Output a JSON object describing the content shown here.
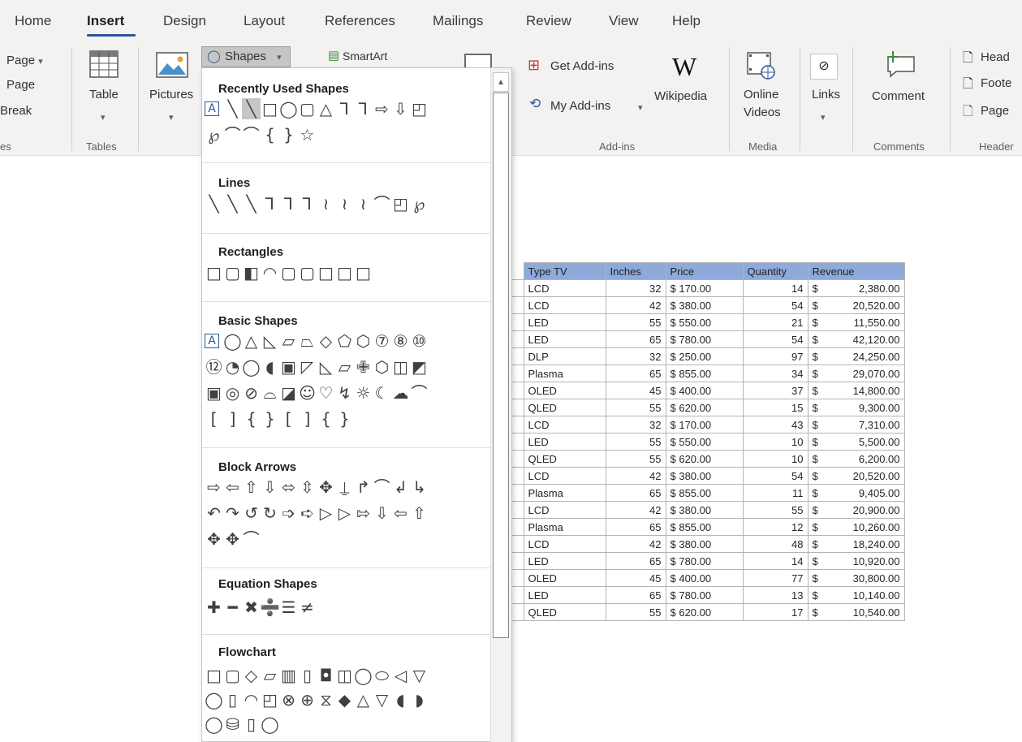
{
  "tabs": [
    "Home",
    "Insert",
    "Design",
    "Layout",
    "References",
    "Mailings",
    "Review",
    "View",
    "Help"
  ],
  "ribbon": {
    "pages_items": [
      "Page",
      "Page",
      "Break"
    ],
    "pages_group_partial": "es",
    "table_label": "Table",
    "tables_group": "Tables",
    "pictures_label": "Pictures",
    "shapes_label": "Shapes",
    "smartart_label": "SmartArt",
    "get_addins_label": "Get Add-ins",
    "my_addins_label": "My Add-ins",
    "wikipedia_label": "Wikipedia",
    "addins_group": "Add-ins",
    "online_videos_label": [
      "Online",
      "Videos"
    ],
    "media_group": "Media",
    "links_label": "Links",
    "comment_label": "Comment",
    "comments_group": "Comments",
    "header_items": [
      "Head",
      "Foote",
      "Page"
    ],
    "header_group": "Header"
  },
  "shapes_menu": {
    "sections": [
      {
        "title": "Recently Used Shapes",
        "rows": [
          "A╲╲□◯▢△⅂⅂⇨⇩◰",
          "℘⌒⌒{}☆"
        ]
      },
      {
        "title": "Lines",
        "rows": [
          "╲╲╲⅂⅂⅂≀≀≀⌒◰℘"
        ]
      },
      {
        "title": "Rectangles",
        "rows": [
          "□▢◧◠▢▢□□□"
        ]
      },
      {
        "title": "Basic Shapes",
        "rows": [
          "A◯△◺▱⏢◇⬠⬡⑦⑧⑩",
          "⑫◔◯◖▣◸◺▱✙⬡◫◩",
          "▣◎⊘⌓◪☺♡↯☼☾☁⌒",
          "[]{}[]{}"
        ]
      },
      {
        "title": "Block Arrows",
        "rows": [
          "⇨⇦⇧⇩⬄⇳✥⍊↱⌒↲↳",
          "↶↷↺↻➩➪▷▷⇰⇩⇦⇧",
          "✥✥⌒"
        ]
      },
      {
        "title": "Equation Shapes",
        "rows": [
          "✚━✖➗☰≠"
        ]
      },
      {
        "title": "Flowchart",
        "rows": [
          "□▢◇▱▥▯◘◫◯⬭◁▽",
          "◯▯◠◰⊗⊕⧖◆△▽◖◗",
          "◯⛁▯◯"
        ]
      }
    ]
  },
  "table": {
    "headers": [
      "Type TV",
      "Inches",
      "Price",
      "Quantity",
      "Revenue"
    ],
    "rows": [
      [
        "LCD",
        "32",
        "$ 170.00",
        "14",
        "$",
        "2,380.00"
      ],
      [
        "LCD",
        "42",
        "$ 380.00",
        "54",
        "$",
        "20,520.00"
      ],
      [
        "LED",
        "55",
        "$ 550.00",
        "21",
        "$",
        "11,550.00"
      ],
      [
        "LED",
        "65",
        "$ 780.00",
        "54",
        "$",
        "42,120.00"
      ],
      [
        "DLP",
        "32",
        "$ 250.00",
        "97",
        "$",
        "24,250.00"
      ],
      [
        "Plasma",
        "65",
        "$ 855.00",
        "34",
        "$",
        "29,070.00"
      ],
      [
        "OLED",
        "45",
        "$ 400.00",
        "37",
        "$",
        "14,800.00"
      ],
      [
        "QLED",
        "55",
        "$ 620.00",
        "15",
        "$",
        "9,300.00"
      ],
      [
        "LCD",
        "32",
        "$ 170.00",
        "43",
        "$",
        "7,310.00"
      ],
      [
        "LED",
        "55",
        "$ 550.00",
        "10",
        "$",
        "5,500.00"
      ],
      [
        "QLED",
        "55",
        "$ 620.00",
        "10",
        "$",
        "6,200.00"
      ],
      [
        "LCD",
        "42",
        "$ 380.00",
        "54",
        "$",
        "20,520.00"
      ],
      [
        "Plasma",
        "65",
        "$ 855.00",
        "11",
        "$",
        "9,405.00"
      ],
      [
        "LCD",
        "42",
        "$ 380.00",
        "55",
        "$",
        "20,900.00"
      ],
      [
        "Plasma",
        "65",
        "$ 855.00",
        "12",
        "$",
        "10,260.00"
      ],
      [
        "LCD",
        "42",
        "$ 380.00",
        "48",
        "$",
        "18,240.00"
      ],
      [
        "LED",
        "65",
        "$ 780.00",
        "14",
        "$",
        "10,920.00"
      ],
      [
        "OLED",
        "45",
        "$ 400.00",
        "77",
        "$",
        "30,800.00"
      ],
      [
        "LED",
        "65",
        "$ 780.00",
        "13",
        "$",
        "10,140.00"
      ],
      [
        "QLED",
        "55",
        "$ 620.00",
        "17",
        "$",
        "10,540.00"
      ]
    ],
    "stub_marks": [
      "",
      "",
      "",
      "",
      "",
      "",
      "",
      "",
      "",
      "",
      "",
      "",
      "",
      "",
      "",
      "",
      "",
      "",
      "",
      ""
    ]
  },
  "colors": {
    "accent": "#2b579a",
    "table_header": "#8eaadb",
    "ribbon_bg": "#f3f2f1"
  }
}
